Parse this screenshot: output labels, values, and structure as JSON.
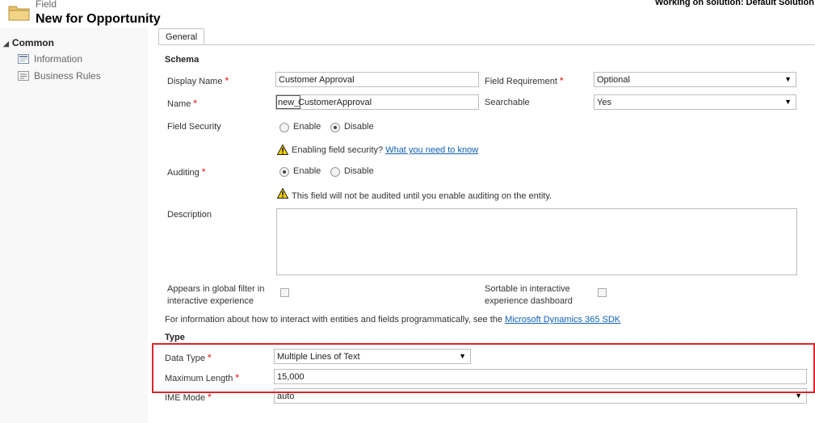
{
  "header": {
    "breadcrumb": "Field",
    "title": "New for Opportunity",
    "solution": "Working on solution: Default Solution"
  },
  "nav": {
    "section": "Common",
    "items": [
      {
        "label": "Information",
        "icon": "information-icon"
      },
      {
        "label": "Business Rules",
        "icon": "business-rules-icon"
      }
    ]
  },
  "tabs": [
    {
      "label": "General"
    }
  ],
  "schema": {
    "heading": "Schema",
    "display_name": {
      "label": "Display Name",
      "value": "Customer Approval"
    },
    "name": {
      "label": "Name",
      "prefix": "new_",
      "value": "CustomerApproval"
    },
    "field_requirement": {
      "label": "Field Requirement",
      "value": "Optional"
    },
    "searchable": {
      "label": "Searchable",
      "value": "Yes"
    },
    "field_security": {
      "label": "Field Security",
      "options": [
        "Enable",
        "Disable"
      ],
      "selected": "Disable"
    },
    "field_security_warning": {
      "text": "Enabling field security?",
      "link": "What you need to know"
    },
    "auditing": {
      "label": "Auditing",
      "options": [
        "Enable",
        "Disable"
      ],
      "selected": "Enable"
    },
    "auditing_warning": "This field will not be audited until you enable auditing on the entity.",
    "description": {
      "label": "Description",
      "value": ""
    },
    "global_filter": {
      "label_line1": "Appears in global filter in",
      "label_line2": "interactive experience",
      "checked": false
    },
    "sortable": {
      "label_line1": "Sortable in interactive",
      "label_line2": "experience dashboard",
      "checked": false
    },
    "sdk_info": {
      "text": "For information about how to interact with entities and fields programmatically, see the",
      "link": "Microsoft Dynamics 365 SDK"
    }
  },
  "type": {
    "heading": "Type",
    "data_type": {
      "label": "Data Type",
      "value": "Multiple Lines of Text"
    },
    "max_length": {
      "label": "Maximum Length",
      "value": "15,000"
    },
    "ime_mode": {
      "label": "IME Mode",
      "value": "auto"
    }
  },
  "colors": {
    "highlight": "#d9262c",
    "link": "#1160b7",
    "required": "#ee0000"
  }
}
